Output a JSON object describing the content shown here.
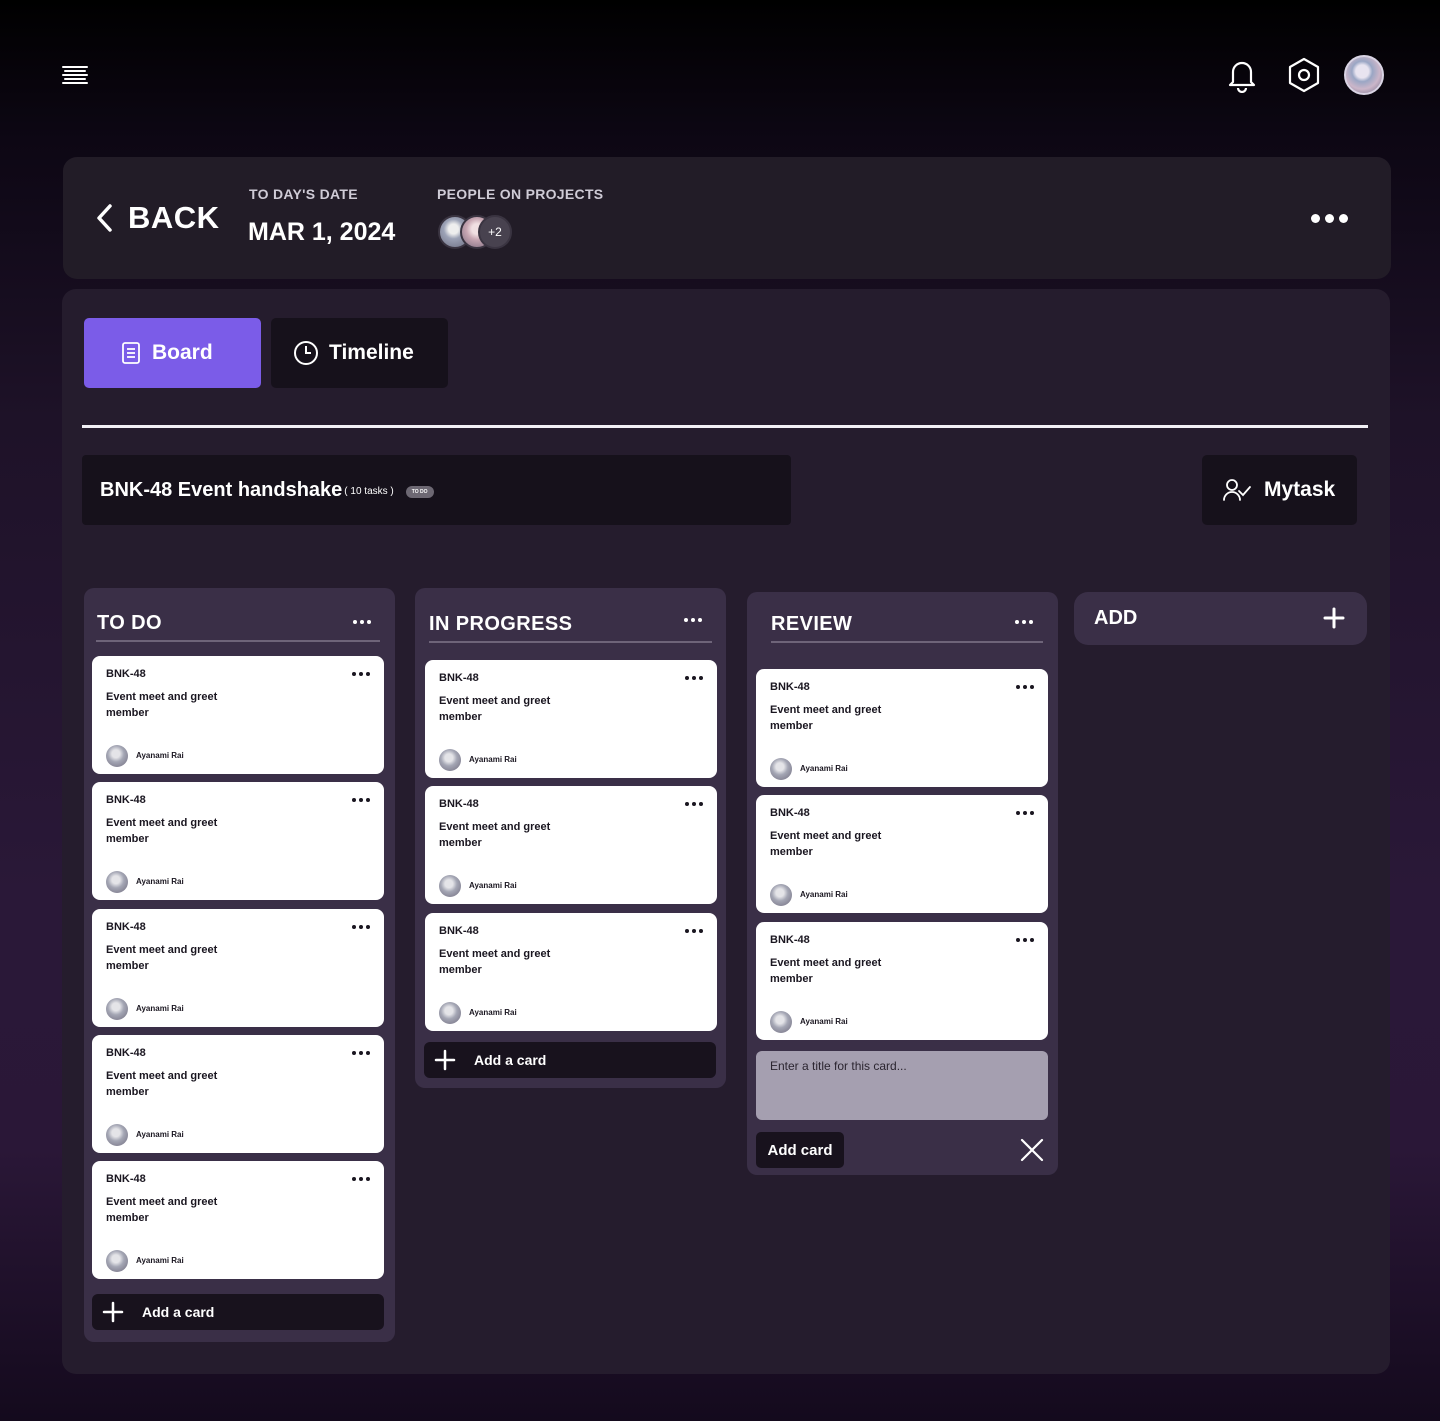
{
  "topbar": {
    "menu_icon": "hamburger-menu-icon",
    "notification_icon": "bell-icon",
    "settings_icon": "hexagon-gear-icon"
  },
  "header": {
    "back_label": "BACK",
    "date_label": "TO DAY'S DATE",
    "date_value": "MAR 1, 2024",
    "people_label": "PEOPLE ON PROJECTS",
    "people_more": "+2"
  },
  "tabs": [
    {
      "label": "Board",
      "active": true
    },
    {
      "label": "Timeline",
      "active": false
    }
  ],
  "project": {
    "title": "BNK-48 Event handshake",
    "task_count": "( 10 tasks )",
    "badge": "TO DO"
  },
  "mytask_label": "Mytask",
  "columns": [
    {
      "title": "TO DO",
      "cards": [
        {
          "id": "BNK-48",
          "title": "Event meet and greet member",
          "assignee": "Ayanami Rai"
        },
        {
          "id": "BNK-48",
          "title": "Event meet and greet member",
          "assignee": "Ayanami Rai"
        },
        {
          "id": "BNK-48",
          "title": "Event meet and greet member",
          "assignee": "Ayanami Rai"
        },
        {
          "id": "BNK-48",
          "title": "Event meet and greet member",
          "assignee": "Ayanami Rai"
        },
        {
          "id": "BNK-48",
          "title": "Event meet and greet member",
          "assignee": "Ayanami Rai"
        }
      ],
      "add_label": "Add a card"
    },
    {
      "title": "IN PROGRESS",
      "cards": [
        {
          "id": "BNK-48",
          "title": "Event meet and greet member",
          "assignee": "Ayanami Rai"
        },
        {
          "id": "BNK-48",
          "title": "Event meet and greet member",
          "assignee": "Ayanami Rai"
        },
        {
          "id": "BNK-48",
          "title": "Event meet and greet member",
          "assignee": "Ayanami Rai"
        }
      ],
      "add_label": "Add a card"
    },
    {
      "title": "REVIEW",
      "cards": [
        {
          "id": "BNK-48",
          "title": "Event meet and greet member",
          "assignee": "Ayanami Rai"
        },
        {
          "id": "BNK-48",
          "title": "Event meet and greet member",
          "assignee": "Ayanami Rai"
        },
        {
          "id": "BNK-48",
          "title": "Event meet and greet member",
          "assignee": "Ayanami Rai"
        }
      ],
      "input_placeholder": "Enter a title for this card...",
      "add_button_label": "Add card"
    }
  ],
  "add_column_label": "ADD",
  "colors": {
    "accent": "#7b5ce8",
    "panel": "#251c2d",
    "column": "#3a2f47",
    "dark_button": "#16111b"
  }
}
